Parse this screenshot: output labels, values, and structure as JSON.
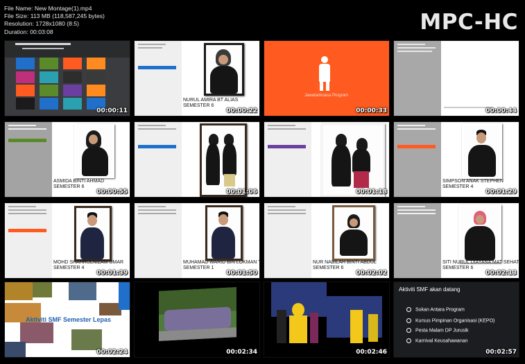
{
  "file_info": {
    "name": "File Name: New Montage(1).mp4",
    "size": "File Size: 113 MB (118,587,245 bytes)",
    "resolution": "Resolution: 1728x1080 (8:5)",
    "duration": "Duration: 00:03:08"
  },
  "brand": "MPC-HC",
  "thumbnails": [
    {
      "time": "00:00:11"
    },
    {
      "time": "00:00:22",
      "caption1": "NURUL AMIRA BT ALIAS",
      "caption2": "SEMESTER 6"
    },
    {
      "time": "00:00:33",
      "caption1": "Jawatankuasa Program"
    },
    {
      "time": "00:00:44"
    },
    {
      "time": "00:00:55",
      "caption1": "ASMIDA BINTI AHMAD",
      "caption2": "SEMESTER 6"
    },
    {
      "time": "00:01:06"
    },
    {
      "time": "00:01:18"
    },
    {
      "time": "00:01:29",
      "caption1": "SIMPSON ANAK STEPHEN",
      "caption2": "SEMESTER 4"
    },
    {
      "time": "00:01:39",
      "caption1": "MOHD SHAHRULNIZAM UMAR",
      "caption2": "SEMESTER 4"
    },
    {
      "time": "00:01:50",
      "caption1": "MUHAMAD WARID BIN LOKMAN TEE",
      "caption2": "SEMESTER 1"
    },
    {
      "time": "00:02:02",
      "caption1": "NUR NABILAH BINTI ABDUL",
      "caption2": "SEMESTER 6"
    },
    {
      "time": "00:02:13",
      "caption1": "SITI NURUL DIAYANA MAT SEHAT",
      "caption2": "SEMESTER 6"
    },
    {
      "time": "00:02:24",
      "caption1": "Aktiviti SMF Semester Lepas"
    },
    {
      "time": "00:02:34"
    },
    {
      "time": "00:02:46"
    },
    {
      "time": "00:02:57",
      "title": "Aktiviti SMF akan datang",
      "items": [
        "Sukan Antara Program",
        "Kursus Pimpinan Organisasi (KEPO)",
        "Pesta Malam DP Jurusik",
        "Karnival Keusahawanan"
      ]
    }
  ],
  "colors": {
    "orange": "#ff5a1f",
    "blue": "#1f6fcb",
    "green": "#5a8a2a",
    "purple": "#6b3fa0",
    "dark_slide": "#1b1d20"
  }
}
